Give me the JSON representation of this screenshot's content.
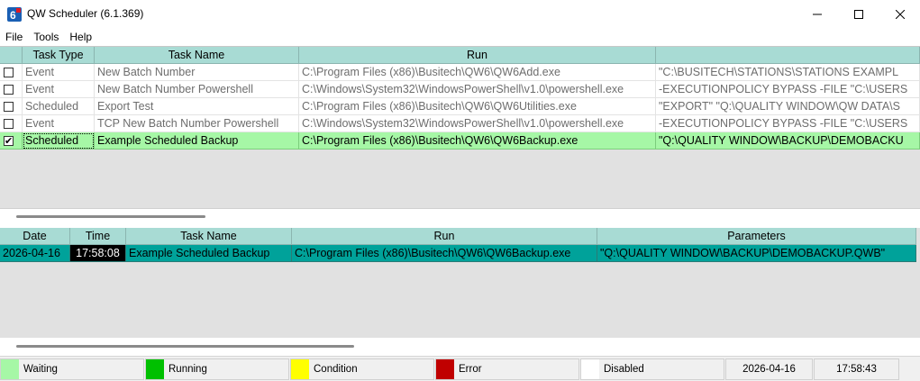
{
  "window": {
    "title": "QW Scheduler (6.1.369)",
    "icon_name": "qw-app-icon"
  },
  "menu": [
    "File",
    "Tools",
    "Help"
  ],
  "tasks": {
    "columns": [
      "",
      "Task Type",
      "Task Name",
      "Run",
      ""
    ],
    "rows": [
      {
        "checked": false,
        "type": "Event",
        "name": "New Batch Number",
        "run": "C:\\Program Files (x86)\\Busitech\\QW6\\QW6Add.exe",
        "params": "\"C:\\BUSITECH\\STATIONS\\STATIONS EXAMPL"
      },
      {
        "checked": false,
        "type": "Event",
        "name": "New Batch Number Powershell",
        "run": "C:\\Windows\\System32\\WindowsPowerShell\\v1.0\\powershell.exe",
        "params": "-EXECUTIONPOLICY BYPASS -FILE \"C:\\USERS"
      },
      {
        "checked": false,
        "type": "Scheduled",
        "name": "Export Test",
        "run": "C:\\Program Files (x86)\\Busitech\\QW6\\QW6Utilities.exe",
        "params": "\"EXPORT\" \"Q:\\QUALITY WINDOW\\QW DATA\\S"
      },
      {
        "checked": false,
        "type": "Event",
        "name": "TCP New Batch Number Powershell",
        "run": "C:\\Windows\\System32\\WindowsPowerShell\\v1.0\\powershell.exe",
        "params": "-EXECUTIONPOLICY BYPASS -FILE \"C:\\USERS"
      },
      {
        "checked": true,
        "type": "Scheduled",
        "name": "Example Scheduled Backup",
        "run": "C:\\Program Files (x86)\\Busitech\\QW6\\QW6Backup.exe",
        "params": "\"Q:\\QUALITY WINDOW\\BACKUP\\DEMOBACKU"
      }
    ]
  },
  "history": {
    "columns": [
      "Date",
      "Time",
      "Task Name",
      "Run",
      "Parameters"
    ],
    "rows": [
      {
        "date": "2026-04-16",
        "time": "17:58:08",
        "name": "Example Scheduled Backup",
        "run": "C:\\Program Files (x86)\\Busitech\\QW6\\QW6Backup.exe",
        "params": "\"Q:\\QUALITY WINDOW\\BACKUP\\DEMOBACKUP.QWB\""
      }
    ]
  },
  "status": {
    "legend": [
      {
        "label": "Waiting",
        "color": "#a6f7a6"
      },
      {
        "label": "Running",
        "color": "#00c000"
      },
      {
        "label": "Condition",
        "color": "#ffff00"
      },
      {
        "label": "Error",
        "color": "#c00000"
      },
      {
        "label": "Disabled",
        "color": "#ffffff"
      }
    ],
    "date": "2026-04-16",
    "time": "17:58:43"
  }
}
